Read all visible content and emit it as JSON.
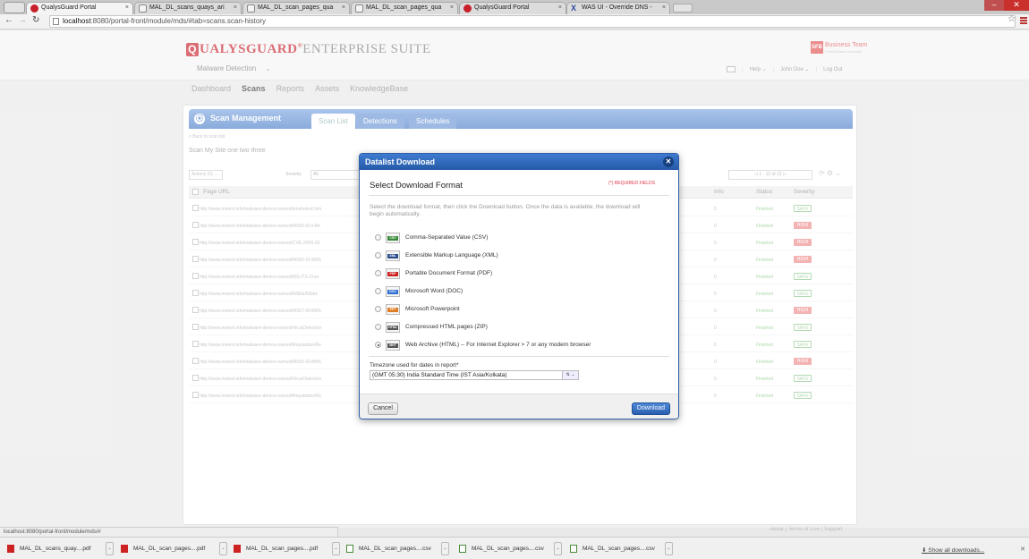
{
  "browser": {
    "tabs": [
      {
        "label": "QualysGuard Portal",
        "icon": "qualys-icon",
        "active": true
      },
      {
        "label": "MAL_DL_scans_quays_ari",
        "icon": "page-icon"
      },
      {
        "label": "MAL_DL_scan_pages_qua",
        "icon": "page-icon"
      },
      {
        "label": "MAL_DL_scan_pages_qua",
        "icon": "page-icon"
      },
      {
        "label": "QualysGuard Portal",
        "icon": "qualys-icon"
      },
      {
        "label": "WAS UI - Override DNS -",
        "icon": "was-icon"
      }
    ],
    "url_host": "localhost",
    "url_rest": ":8080/portal-front/module/mds/#tab=scans.scan-history"
  },
  "header": {
    "logo_q": "Q",
    "logo_brand": "UALYSGUARD",
    "logo_reg": "®",
    "logo_suite": "ENTERPRISE SUITE",
    "org_badge": "SFB",
    "org_name": "Business Team",
    "org_sub": "FreeSoftware test suite",
    "module": "Malware Detection",
    "help": "Help",
    "user": "John Doe",
    "logout": "Log Out"
  },
  "main_nav": [
    "Dashboard",
    "Scans",
    "Reports",
    "Assets",
    "KnowledgeBase"
  ],
  "scan_mgmt": {
    "title": "Scan Management",
    "tabs": [
      "Scan List",
      "Detections",
      "Schedules"
    ],
    "back": "< Back to scan list",
    "scan_name": "Scan My Site one two three",
    "actions_label": "Actions (0)",
    "severity_label": "Severity",
    "severity_value": "All",
    "pager": "1 - 12 of 12",
    "columns": {
      "url": "Page URL",
      "info": "Info",
      "status": "Status",
      "severity": "Severity"
    },
    "rows": [
      {
        "url": "http://www.mvtest.info/malware-demos-named/smoketest.htm",
        "info": "0",
        "status": "Finished",
        "severity": "SAFE"
      },
      {
        "url": "http://www.mvtest.info/malware-demos-named/MS06-014-Re",
        "info": "0",
        "status": "Finished",
        "severity": "HIGH"
      },
      {
        "url": "http://www.mvtest.info/malware-demos-named/CVE-2009-26",
        "info": "0",
        "status": "Finished",
        "severity": "HIGH"
      },
      {
        "url": "http://www.mvtest.info/malware-demos-named/MS06-014/MS",
        "info": "0",
        "status": "Finished",
        "severity": "HIGH"
      },
      {
        "url": "http://www.mvtest.info/malware-demos-named/MS-ITS-Cros",
        "info": "0",
        "status": "Finished",
        "severity": "SAFE"
      },
      {
        "url": "http://www.mvtest.info/malware-demos-named/Kilbits/Kilbits",
        "info": "0",
        "status": "Finished",
        "severity": "SAFE"
      },
      {
        "url": "http://www.mvtest.info/malware-demos-named/MS07-004/MS",
        "info": "0",
        "status": "Finished",
        "severity": "HIGH"
      },
      {
        "url": "http://www.mvtest.info/malware-demos-named/VirusDetection",
        "info": "0",
        "status": "Finished",
        "severity": "SAFE"
      },
      {
        "url": "http://www.mvtest.info/malware-demos-named/Reputation/Re",
        "info": "0",
        "status": "Finished",
        "severity": "SAFE"
      },
      {
        "url": "http://www.mvtest.info/malware-demos-named/MS06-014/MS",
        "info": "0",
        "status": "Finished",
        "severity": "HIGH"
      },
      {
        "url": "http://www.mvtest.info/malware-demos-named/VirusDetection",
        "info": "0",
        "status": "Finished",
        "severity": "SAFE"
      },
      {
        "url": "http://www.mvtest.info/malware-demos-named/Reputation/Re",
        "info": "0",
        "status": "Finished",
        "severity": "SAFE"
      }
    ]
  },
  "footer_links": "About | Terms of Use | Support",
  "modal": {
    "title": "Datalist Download",
    "subtitle": "Select Download Format",
    "required": "(*) REQUIRED FIELDS",
    "description": "Select the download format, then click the Download button. Once the data is available, the download will begin automatically.",
    "options": [
      {
        "tag": "CSV",
        "label": "Comma-Separated Value (CSV)",
        "color": "#3a8a3a",
        "selected": false
      },
      {
        "tag": "XML",
        "label": "Extensible Markup Language (XML)",
        "color": "#2d4e8c",
        "selected": false
      },
      {
        "tag": "PDF",
        "label": "Portable Document Format (PDF)",
        "color": "#cc2222",
        "selected": false
      },
      {
        "tag": "DOC",
        "label": "Microsoft Word (DOC)",
        "color": "#2f6fcf",
        "selected": false
      },
      {
        "tag": "PPT",
        "label": "Microsoft Powerpoint",
        "color": "#e07a20",
        "selected": false
      },
      {
        "tag": "HTML",
        "label": "Compressed HTML pages (ZIP)",
        "color": "#555555",
        "selected": false
      },
      {
        "tag": "MHT",
        "label": "Web Archive (HTML) -- For Internet Explorer > 7 or any modern browser",
        "color": "#555555",
        "selected": true
      }
    ],
    "tz_label": "Timezone used for dates in report*",
    "tz_value": "(GMT 05:30) India Standard Time (IST Asia/Kolkata)",
    "cancel": "Cancel",
    "download": "Download"
  },
  "status_url": "localhost:8080/portal-front/module/mds/#",
  "downloads": [
    {
      "name": "MAL_DL_scans_quay....pdf",
      "type": "pdf"
    },
    {
      "name": "MAL_DL_scan_pages....pdf",
      "type": "pdf"
    },
    {
      "name": "MAL_DL_scan_pages....pdf",
      "type": "pdf"
    },
    {
      "name": "MAL_DL_scan_pages....csv",
      "type": "csv"
    },
    {
      "name": "MAL_DL_scan_pages....csv",
      "type": "csv"
    },
    {
      "name": "MAL_DL_scan_pages....csv",
      "type": "csv"
    }
  ],
  "show_all": "Show all downloads..."
}
